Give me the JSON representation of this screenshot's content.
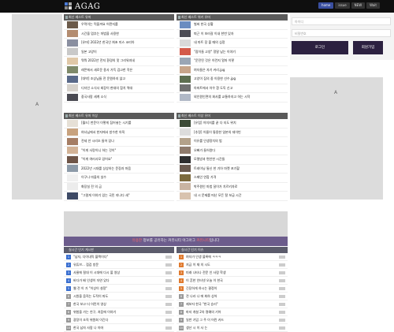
{
  "header": {
    "logo_text": "AGAG",
    "nav": [
      "home",
      "issue",
      "NEW",
      "Wait"
    ]
  },
  "ads": {
    "left_mark": "A",
    "right_mark": "A"
  },
  "login": {
    "id_placeholder": "아이디",
    "pw_placeholder": "비밀번호",
    "login_label": "로그인",
    "join_label": "회원가입"
  },
  "panels": [
    {
      "title": "최신 베스트 유머",
      "items": [
        "우럭이는 먹을까요 어떤지를",
        "시간을 멈추는 마법을 사용한",
        "[유머] 2022년 한국인 최초 미스 코리아",
        "일본 고양이",
        "뭐뭐 2022년 전지 환경의 맛 그리워지네",
        "레몬에서 새로운 용사 가득 검고한 작은",
        "[대박] 조상님들 전 문원하지 않고",
        "디자인 소식사 회장이 현대의 참치 역대",
        "중국사람 세계 소식"
      ]
    },
    {
      "title": "최신 베스트 위키 유머",
      "items": [
        "벌써 한국 상황",
        "퇴근 이 보러갈 이내 한번 있자",
        "내 마트 장 볼 때의 심정",
        "\"잠이들 고양\" 정말 남는 이야기",
        "\"운전된 것은 이런지 얼마 이렇",
        "여자들은 자기 커리.jpg",
        "고양이 집의 중 이용한 선수.jpg",
        "아파트에서 아우 흰 도둑 신고",
        "외인원인면의 회사를 교통하지고 하는 시작"
      ]
    },
    {
      "title": "최신 베스트 유머 이상",
      "items": [
        "[월드] 천문이 이렇게 집어넣는 시기를",
        "여사님에서 한자에서 방수한 아직",
        "전세 안 시리조 들어 있나",
        "\"이게 사랑이니 하는 것이\"",
        "\"이게 여러사모 있어요\"",
        "2022년 시대를 상상하는 문장과 마음",
        "이구나 마을의 실수",
        "화장실 전 의 금",
        "\"그럴게 이야기 있는 국민 지나다 새\""
      ]
    },
    {
      "title": "최신 베스트 이상 유머",
      "items": [
        "[유럽] 이미지를 끝 다 지도 위치",
        "[추정] 이름이 통용한 일본의 데이빈",
        "이유를 인생정치의 법",
        "오빠가 들어왔다",
        "모델방과 편안한 시간들",
        "트레이닝 통신 한 기아 마켓 포기할",
        "스페인 연합 가격",
        "박주원인 마법 달이가 치르키자로",
        "내 시 문제를 떠난 모든 탈 보급 시간"
      ]
    }
  ],
  "notice": {
    "pre": "",
    "hl1": "유용한",
    "mid": " 정보를 공유하는 커뮤니티 아그아그 ",
    "hl2": "커뮤니티",
    "post": "입니다"
  },
  "lists": [
    {
      "title": "실시간 인기 게시판",
      "items": [
        "\"남자, 다이내믹 블랙이다\"",
        "유튜브... 점검 방문",
        "사물에 절대 이 시대에 다시 볼 영상",
        "바다가 배 인생이 자연 있다",
        "웹 전 이 가 \"이상이 설정\"",
        "시원을 움직는 도적이 파도",
        "한국 보고 더 어린이 영상",
        "위험을 가는 친구, 처음에 이야기",
        "광장이 조직 위원회 이긴다",
        "한국 남자 사람 나 아마"
      ]
    },
    {
      "title": "실시간 인기 이슈",
      "items": [
        "여자가 인생 블록에 ㅋㅋㅋ",
        "지금 이 재 의 시도",
        "미래 나타나 전문 인 사람 학생",
        "이 흔한 인터넷 오늘 이 한국",
        "긴장하게 하시는 결정이",
        "전 나라 나 에 최하 상어",
        "제보자 한국 \"한국 승리\"",
        "마지 개설 2차 명예의 기어",
        "일반 기업 그 주 이 어린 카드",
        "생산 시 이 사 는"
      ]
    }
  ],
  "colors": {
    "topbar": "#0f0f0f",
    "accent": "#3a4fa0",
    "notice": "#6c5c8c",
    "login_btn": "#2c2140"
  }
}
